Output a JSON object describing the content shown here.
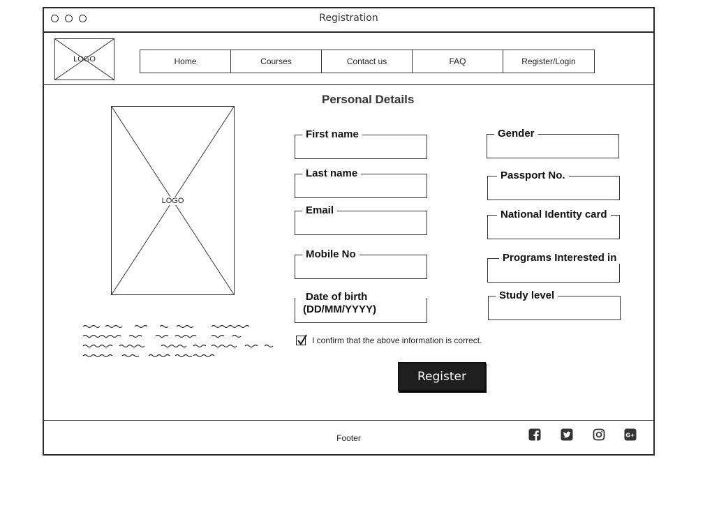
{
  "window": {
    "title": "Registration",
    "controls": [
      "close-circle",
      "minimize-circle",
      "maximize-circle"
    ]
  },
  "header": {
    "logo_text": "LOGO",
    "nav": [
      {
        "label": "Home"
      },
      {
        "label": "Courses"
      },
      {
        "label": "Contact us"
      },
      {
        "label": "FAQ"
      },
      {
        "label": "Register/Login"
      }
    ]
  },
  "main": {
    "section_title": "Personal Details",
    "image_placeholder_text": "LOGO",
    "left_fields": [
      {
        "label": "First name"
      },
      {
        "label": "Last name"
      },
      {
        "label": "Email"
      },
      {
        "label": "Mobile No"
      }
    ],
    "dob": {
      "line1": "Date of birth",
      "line2": "(DD/MM/YYYY)"
    },
    "right_fields": [
      {
        "label": "Gender"
      },
      {
        "label": "Passport No."
      },
      {
        "label": "National Identity card"
      },
      {
        "label": "Programs Interested in"
      },
      {
        "label": "Study level"
      }
    ],
    "confirm_checked": true,
    "confirm_text": "I confirm that the above information is correct.",
    "register_label": "Register"
  },
  "footer": {
    "text": "Footer",
    "social_icons": [
      "facebook-icon",
      "twitter-icon",
      "instagram-icon",
      "google-plus-icon"
    ]
  }
}
